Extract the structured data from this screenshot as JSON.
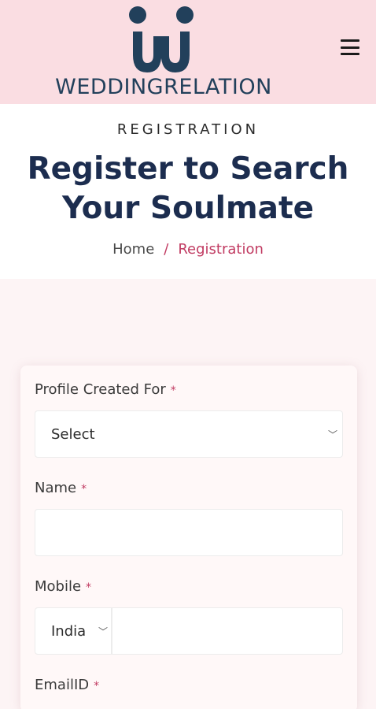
{
  "header": {
    "logo_text": "WEDDINGRELATION",
    "menu_icon": "hamburger-menu-icon"
  },
  "hero": {
    "eyebrow": "REGISTRATION",
    "title": "Register to Search Your Soulmate",
    "breadcrumb": {
      "home": "Home",
      "separator": "/",
      "current": "Registration"
    }
  },
  "form": {
    "profile_for": {
      "label": "Profile Created For",
      "required": "*",
      "value": "Select"
    },
    "name": {
      "label": "Name",
      "required": "*",
      "value": ""
    },
    "mobile": {
      "label": "Mobile",
      "required": "*",
      "country": "India",
      "value": ""
    },
    "email": {
      "label": "EmailID",
      "required": "*"
    }
  },
  "colors": {
    "header_bg": "#fadde2",
    "brand_navy": "#1c2d4f",
    "accent": "#c13b62",
    "section_bg": "#fdf4f5"
  }
}
